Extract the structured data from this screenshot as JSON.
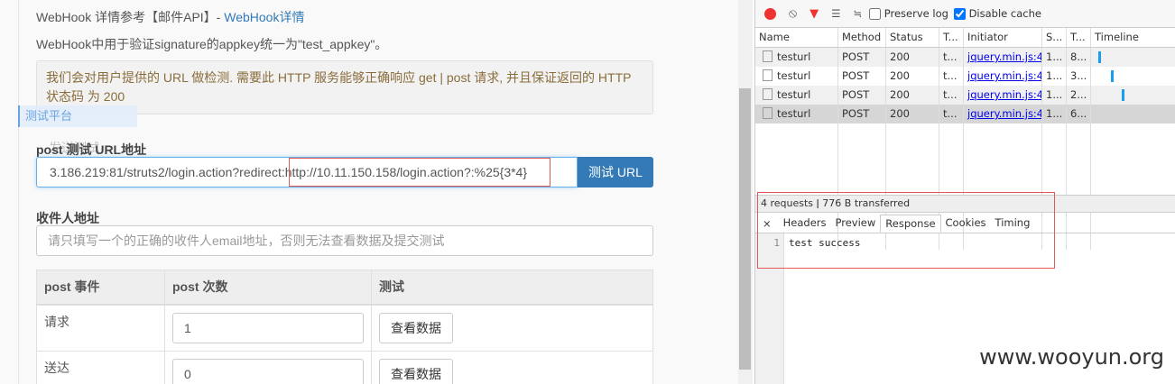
{
  "page": {
    "ref_prefix": "WebHook 详情参考【邮件API】- ",
    "ref_link": "WebHook详情",
    "appkey_note": "WebHook中用于验证signature的appkey统一为\"test_appkey\"。",
    "notice": "我们会对用户提供的 URL 做检测. 需要此 HTTP 服务能够正确响应 get | post 请求, 并且保证返回的 HTTP 状态码 为 200",
    "side_tab": "测试平台",
    "overlap_label": "发送测试",
    "url_label": "post 测试 URL地址",
    "url_value": "3.186.219:81/struts2/login.action?redirect:http://10.11.150.158/login.action?:%25{3*4}",
    "test_url_button": "测试 URL",
    "recipient_label": "收件人地址",
    "recipient_placeholder": "请只填写一个的正确的收件人email地址，否则无法查看数据及提交测试",
    "table": {
      "headers": [
        "post 事件",
        "post 次数",
        "测试"
      ],
      "rows": [
        {
          "event": "请求",
          "count": "1",
          "button": "查看数据"
        },
        {
          "event": "送达",
          "count": "0",
          "button": "查看数据"
        }
      ]
    }
  },
  "devtools": {
    "preserve_log": "Preserve log",
    "preserve_log_checked": false,
    "disable_cache": "Disable cache",
    "disable_cache_checked": true,
    "columns": [
      "Name",
      "Method",
      "Status",
      "T...",
      "Initiator",
      "S...",
      "T...",
      "Timeline"
    ],
    "rows": [
      {
        "name": "testurl",
        "method": "POST",
        "status": "200",
        "type": "t...",
        "initiator": "jquery.min.js:4",
        "size": "1...",
        "time": "8..."
      },
      {
        "name": "testurl",
        "method": "POST",
        "status": "200",
        "type": "t...",
        "initiator": "jquery.min.js:4",
        "size": "1...",
        "time": "3..."
      },
      {
        "name": "testurl",
        "method": "POST",
        "status": "200",
        "type": "t...",
        "initiator": "jquery.min.js:4",
        "size": "1...",
        "time": "2..."
      },
      {
        "name": "testurl",
        "method": "POST",
        "status": "200",
        "type": "t...",
        "initiator": "jquery.min.js:4",
        "size": "1...",
        "time": "6..."
      }
    ],
    "summary": "4 requests  ǀ  776 B transferred",
    "tabs": [
      "Headers",
      "Preview",
      "Response",
      "Cookies",
      "Timing"
    ],
    "active_tab": "Response",
    "response_line_no": "1",
    "response_text": "test success",
    "timeline_color": "#1a9cf0"
  },
  "watermark": "www.wooyun.org"
}
